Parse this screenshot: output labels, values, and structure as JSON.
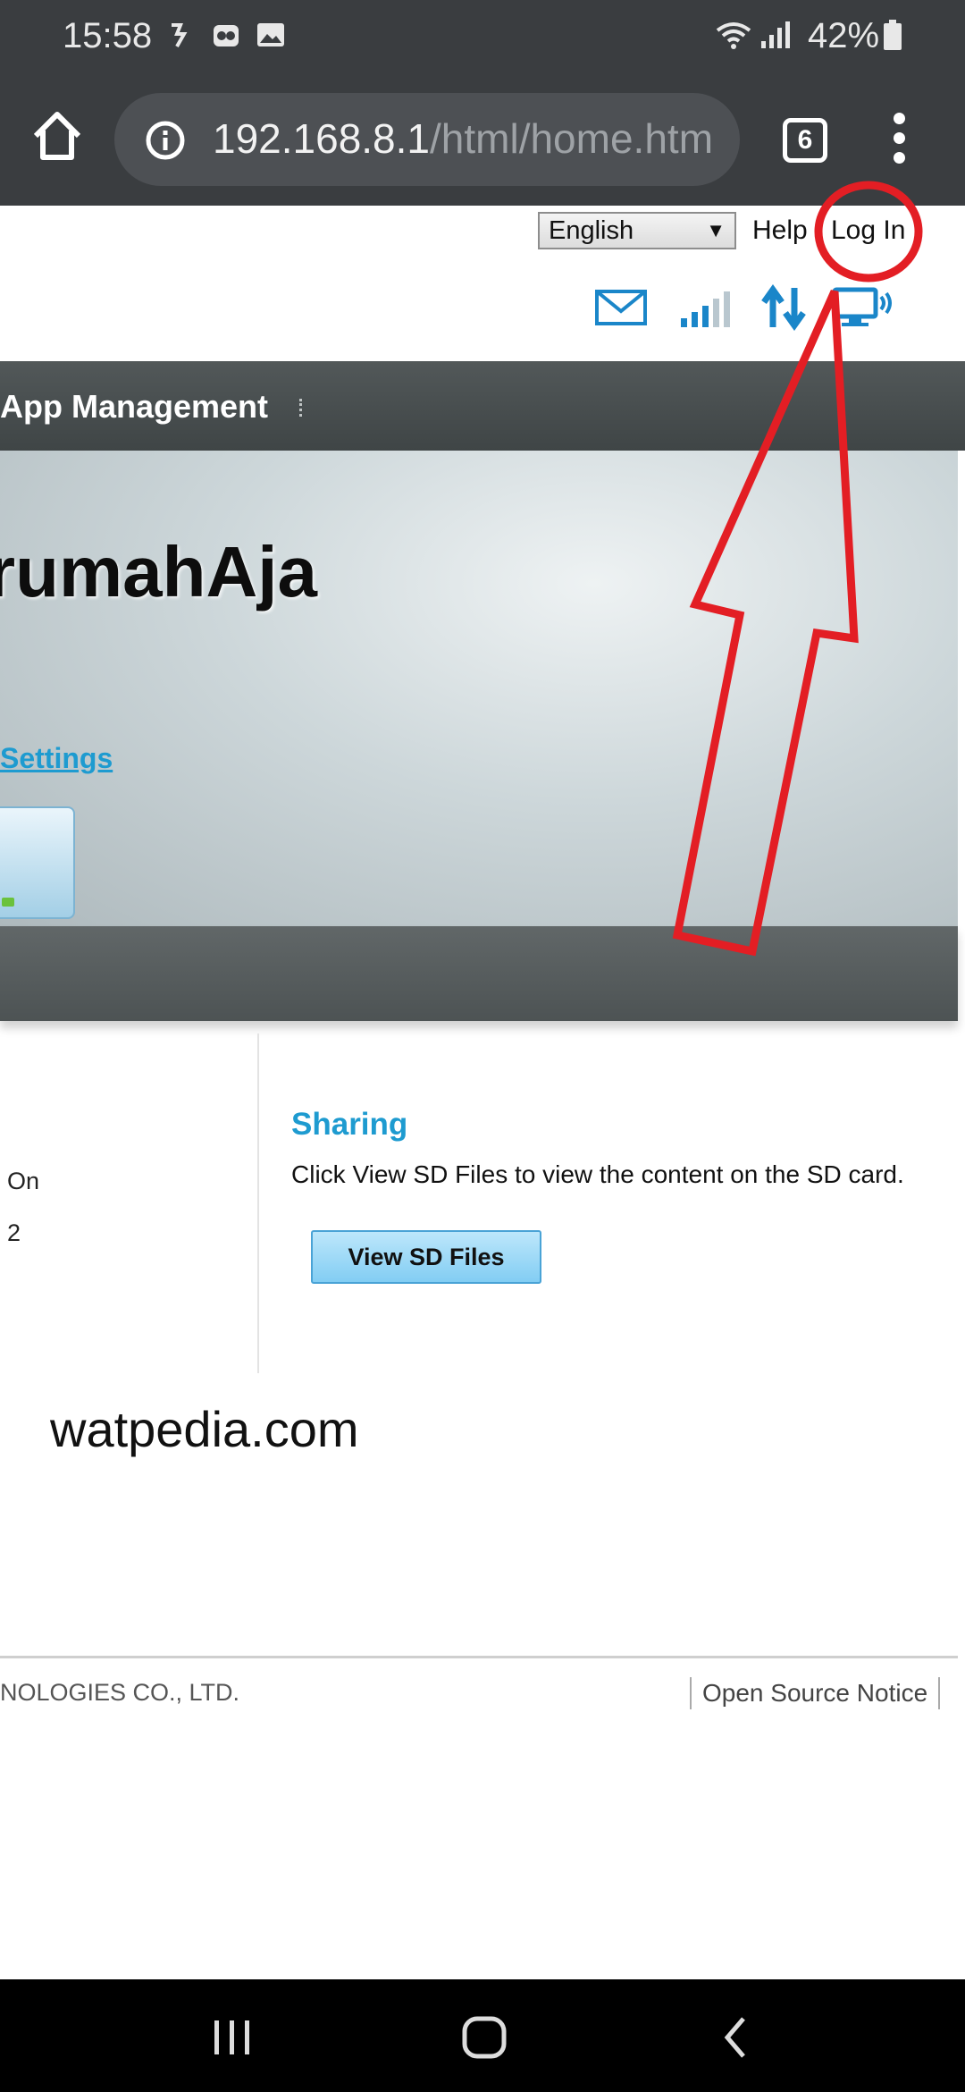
{
  "status_bar": {
    "time": "15:58",
    "battery_text": "42%",
    "icons": [
      "notification-app-icon",
      "tripadvisor-icon",
      "gallery-icon",
      "wifi-icon",
      "signal-icon",
      "battery-icon"
    ]
  },
  "browser": {
    "url_host": "192.168.8.1",
    "url_path": "/html/home.htm",
    "tab_count": "6"
  },
  "page": {
    "language_selected": "English",
    "help_label": "Help",
    "login_label": "Log In",
    "nav_item": "App Management",
    "banner_title": "rumahAja",
    "settings_link": "Settings",
    "left_values": [
      "On",
      "2"
    ],
    "sharing": {
      "title": "Sharing",
      "description": "Click View SD Files to view the content on the SD card.",
      "button_label": "View SD Files"
    },
    "footer": {
      "copyright": "NOLOGIES CO., LTD.",
      "open_source_notice": "Open Source Notice"
    }
  },
  "watermark": "watpedia.com",
  "colors": {
    "link_blue": "#1e9bd0",
    "annotation_red": "#e31e24",
    "icon_blue": "#1a86c9"
  }
}
